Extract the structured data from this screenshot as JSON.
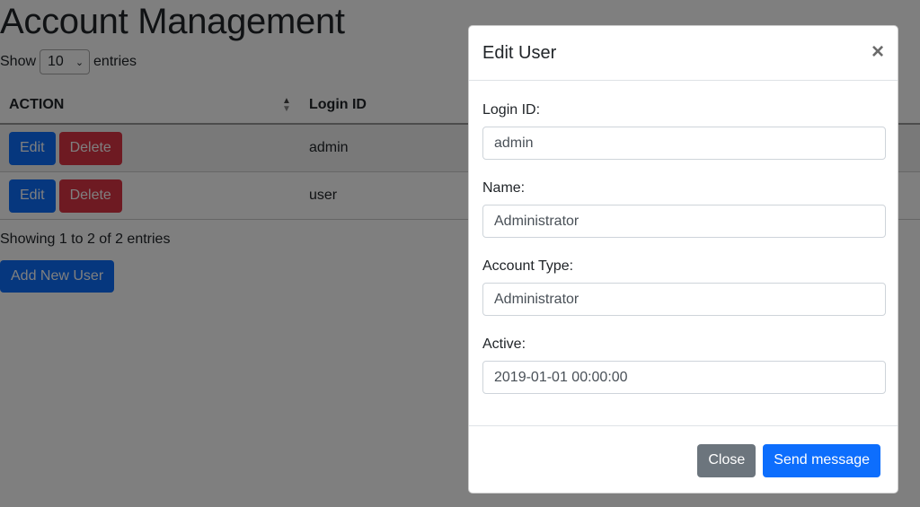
{
  "page": {
    "title": "Account Management",
    "length": {
      "show_label": "Show",
      "value": "10",
      "entries_label": "entries"
    },
    "table": {
      "headers": {
        "action": "ACTION",
        "login_id": "Login ID"
      },
      "rows": [
        {
          "edit_label": "Edit",
          "delete_label": "Delete",
          "login_id": "admin"
        },
        {
          "edit_label": "Edit",
          "delete_label": "Delete",
          "login_id": "user"
        }
      ]
    },
    "info": "Showing 1 to 2 of 2 entries",
    "add_button": "Add New User"
  },
  "modal": {
    "title": "Edit User",
    "close_symbol": "×",
    "fields": [
      {
        "label": "Login ID:",
        "value": "admin"
      },
      {
        "label": "Name:",
        "value": "Administrator"
      },
      {
        "label": "Account Type:",
        "value": "Administrator"
      },
      {
        "label": "Active:",
        "value": "2019-01-01 00:00:00"
      }
    ],
    "close_button": "Close",
    "send_button": "Send message"
  },
  "colors": {
    "primary": "#0d6efd",
    "danger": "#dc3545",
    "secondary": "#6c757d",
    "backdrop": "rgba(0,0,0,0.5)"
  },
  "icons": [
    "sort-icon",
    "close-icon",
    "chevron-down-icon"
  ]
}
